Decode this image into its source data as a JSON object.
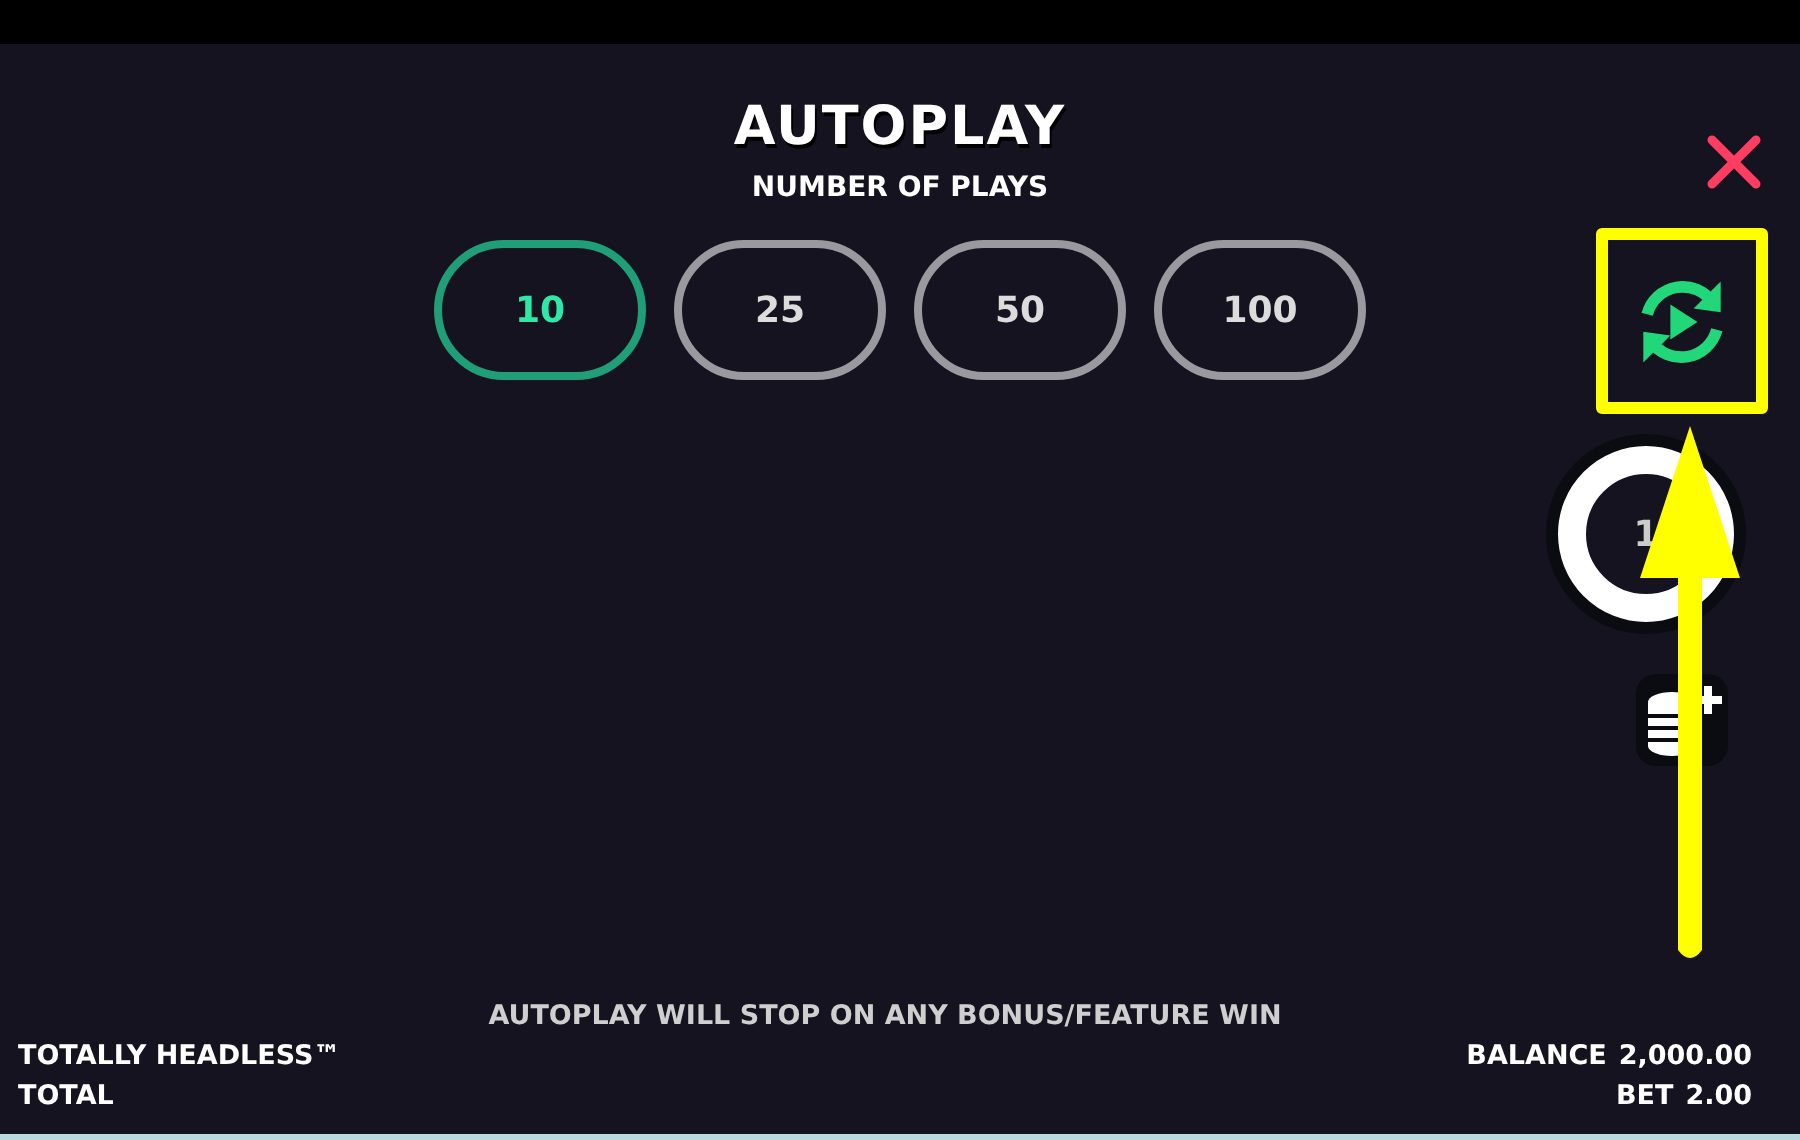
{
  "title": "AUTOPLAY",
  "subtitle": "NUMBER OF PLAYS",
  "play_options": [
    {
      "label": "10",
      "selected": true
    },
    {
      "label": "25",
      "selected": false
    },
    {
      "label": "50",
      "selected": false
    },
    {
      "label": "100",
      "selected": false
    }
  ],
  "spin_button": {
    "label": "1"
  },
  "notice": "AUTOPLAY WILL STOP ON ANY BONUS/FEATURE WIN",
  "game_name": "TOTALLY HEADLESS™",
  "total_label": "TOTAL",
  "balance": {
    "label": "BALANCE",
    "value": "2,000.00"
  },
  "bet": {
    "label": "BET",
    "value": "2.00"
  }
}
